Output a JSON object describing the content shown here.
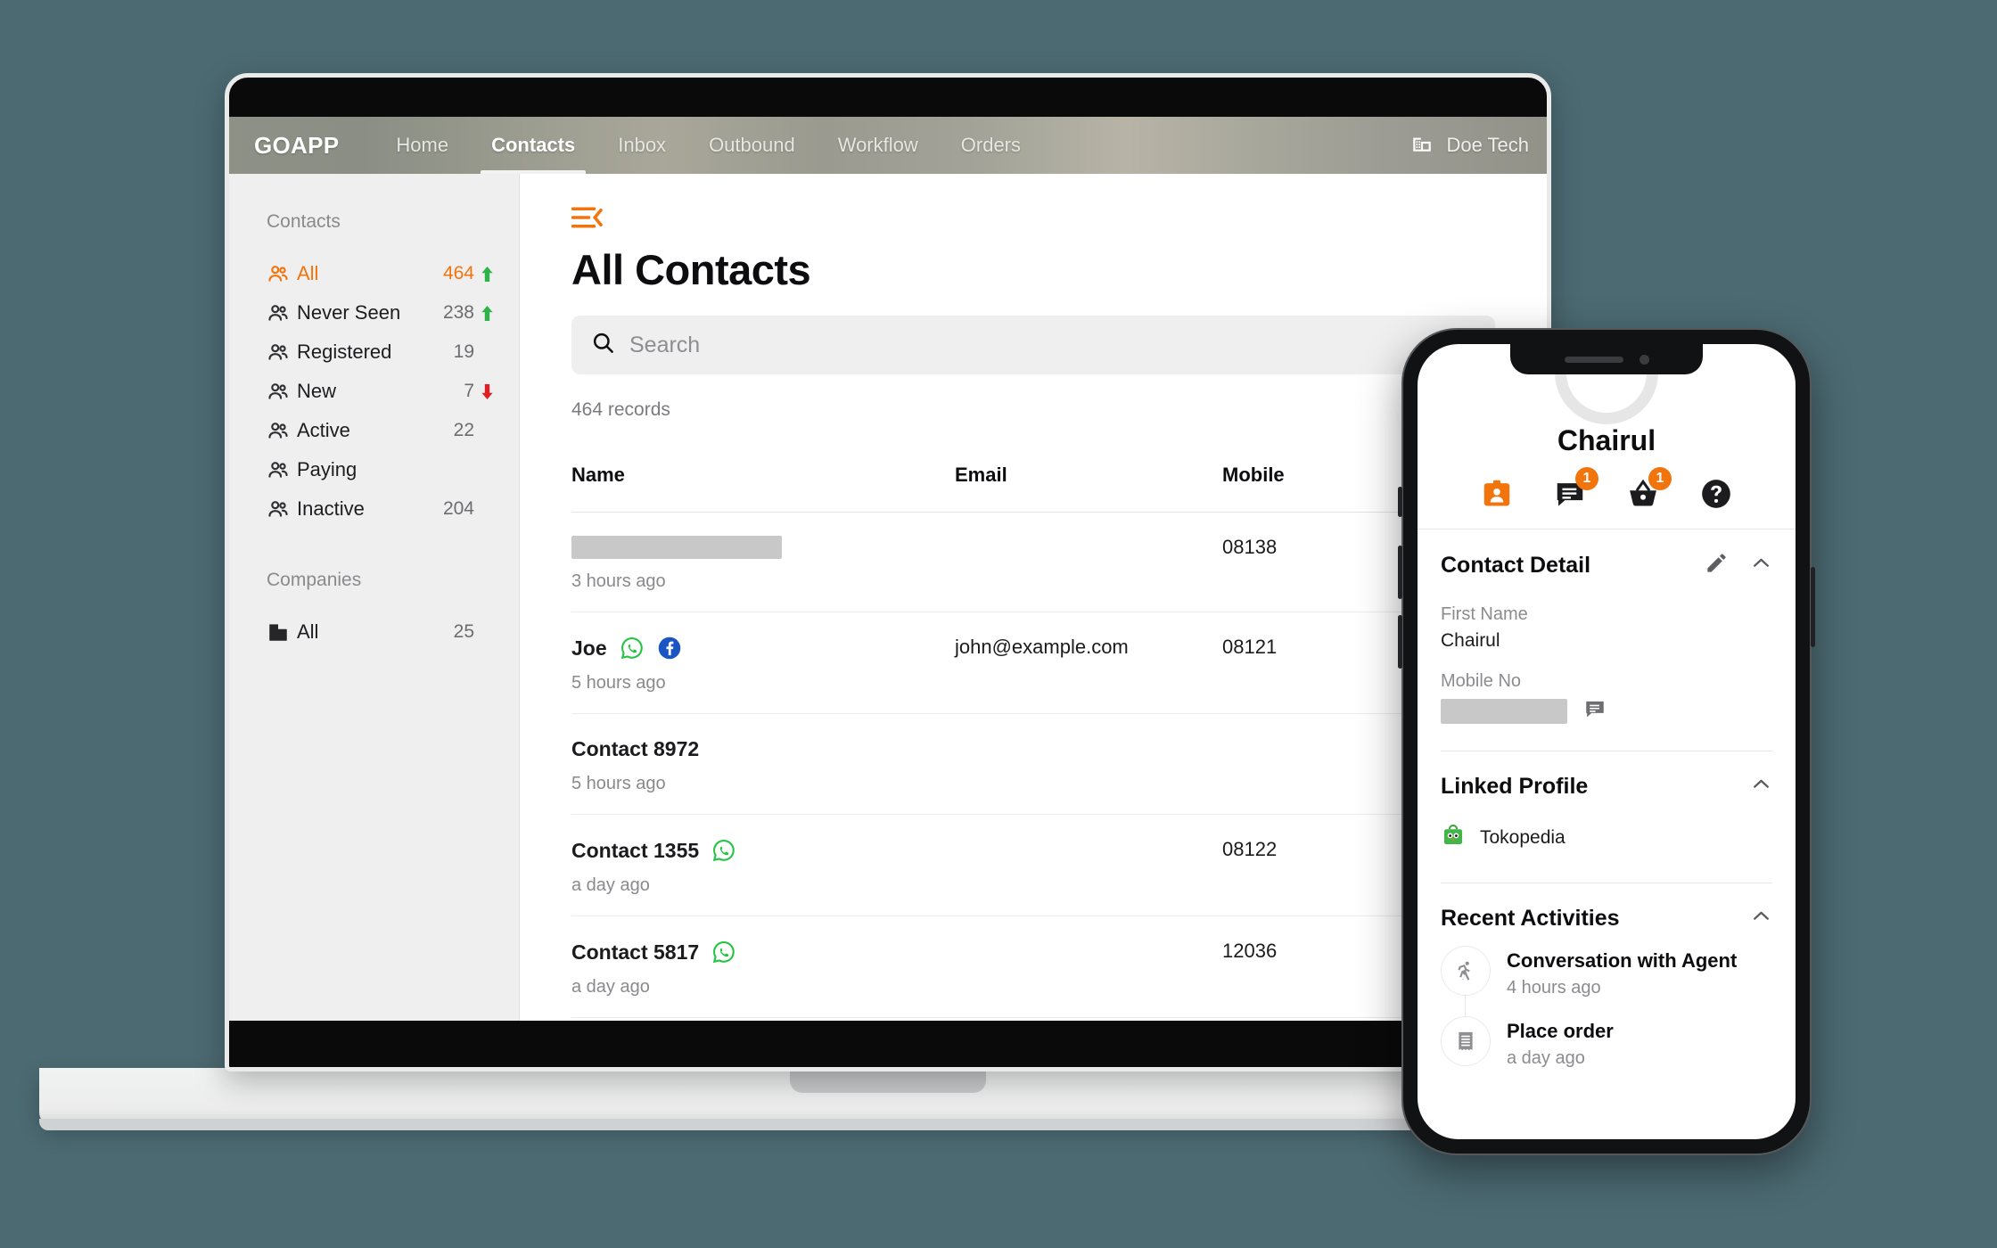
{
  "app": {
    "brand": "GOAPP",
    "nav_items": [
      {
        "label": "Home",
        "active": false
      },
      {
        "label": "Contacts",
        "active": true
      },
      {
        "label": "Inbox",
        "active": false
      },
      {
        "label": "Outbound",
        "active": false
      },
      {
        "label": "Workflow",
        "active": false
      },
      {
        "label": "Orders",
        "active": false
      }
    ],
    "account_name": "Doe Tech",
    "account_icon": "building-icon",
    "accent_color": "#f2740d",
    "nav_bg_color": "#9b9b90"
  },
  "sidebar": {
    "section_contacts": "Contacts",
    "section_companies": "Companies",
    "contact_items": [
      {
        "label": "All",
        "count": "464",
        "trend": "up",
        "active": true,
        "icon": "people-icon"
      },
      {
        "label": "Never Seen",
        "count": "238",
        "trend": "up",
        "active": false,
        "icon": "people-icon"
      },
      {
        "label": "Registered",
        "count": "19",
        "trend": "none",
        "active": false,
        "icon": "people-icon"
      },
      {
        "label": "New",
        "count": "7",
        "trend": "down",
        "active": false,
        "icon": "people-icon"
      },
      {
        "label": "Active",
        "count": "22",
        "trend": "none",
        "active": false,
        "icon": "people-icon"
      },
      {
        "label": "Paying",
        "count": "",
        "trend": "none",
        "active": false,
        "icon": "people-icon"
      },
      {
        "label": "Inactive",
        "count": "204",
        "trend": "none",
        "active": false,
        "icon": "people-icon"
      }
    ],
    "company_items": [
      {
        "label": "All",
        "count": "25",
        "trend": "none",
        "active": false,
        "icon": "building-icon"
      }
    ],
    "trend_up_color": "#2eb34a",
    "trend_down_color": "#e02020"
  },
  "main": {
    "collapse_icon": "collapse-sidebar-icon",
    "page_title": "All Contacts",
    "search_placeholder": "Search",
    "search_value": "",
    "search_icon": "search-icon",
    "record_count_label": "464 records",
    "columns": [
      "Name",
      "Email",
      "Mobile"
    ],
    "rows": [
      {
        "name": "",
        "redacted": true,
        "time": "3 hours ago",
        "email": "",
        "mobile": "08138",
        "whatsapp": false,
        "facebook": false
      },
      {
        "name": "Joe",
        "redacted": false,
        "time": "5 hours ago",
        "email": "john@example.com",
        "mobile": "08121",
        "whatsapp": true,
        "facebook": true
      },
      {
        "name": "Contact 8972",
        "redacted": false,
        "time": "5 hours ago",
        "email": "",
        "mobile": "",
        "whatsapp": false,
        "facebook": false
      },
      {
        "name": "Contact 1355",
        "redacted": false,
        "time": "a day ago",
        "email": "",
        "mobile": "08122",
        "whatsapp": true,
        "facebook": false
      },
      {
        "name": "Contact 5817",
        "redacted": false,
        "time": "a day ago",
        "email": "",
        "mobile": "12036",
        "whatsapp": true,
        "facebook": false
      }
    ]
  },
  "phone": {
    "contact_name": "Chairul",
    "tabs": [
      {
        "icon": "contact-card-icon",
        "badge": "",
        "active": true
      },
      {
        "icon": "chat-icon",
        "badge": "1",
        "active": false
      },
      {
        "icon": "basket-icon",
        "badge": "1",
        "active": false
      },
      {
        "icon": "help-icon",
        "badge": "",
        "active": false
      }
    ],
    "contact_detail": {
      "title": "Contact Detail",
      "edit_icon": "pencil-icon",
      "collapse_icon": "chevron-up-icon",
      "first_name_label": "First Name",
      "first_name_value": "Chairul",
      "mobile_label": "Mobile No",
      "mobile_value": "",
      "mobile_redacted": true,
      "message_icon": "message-icon"
    },
    "linked_profile": {
      "title": "Linked Profile",
      "collapse_icon": "chevron-up-icon",
      "items": [
        {
          "label": "Tokopedia",
          "icon": "tokopedia-icon"
        }
      ]
    },
    "recent_activities": {
      "title": "Recent Activities",
      "collapse_icon": "chevron-up-icon",
      "items": [
        {
          "title": "Conversation with Agent",
          "time": "4 hours ago",
          "icon": "running-person-icon"
        },
        {
          "title": "Place order",
          "time": "a day ago",
          "icon": "receipt-icon"
        }
      ]
    }
  }
}
